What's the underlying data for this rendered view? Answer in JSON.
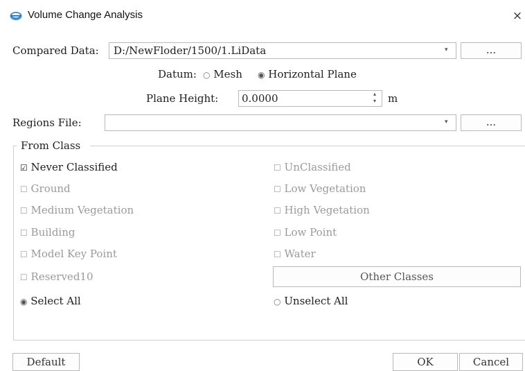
{
  "window": {
    "title": "Volume Change Analysis",
    "close_glyph": "×"
  },
  "compared_data": {
    "label": "Compared Data:",
    "value": "D:/NewFloder/1500/1.LiData",
    "browse_label": "..."
  },
  "datum": {
    "label": "Datum:",
    "options": [
      "Mesh",
      "Horizontal Plane"
    ],
    "selected": "Horizontal Plane"
  },
  "plane_height": {
    "label": "Plane Height:",
    "value": "0.0000",
    "unit": "m"
  },
  "regions_file": {
    "label": "Regions File:",
    "value": "",
    "browse_label": "..."
  },
  "from_class": {
    "legend": "From Class",
    "classes": [
      {
        "label": "Never Classified",
        "checked": true,
        "enabled": true
      },
      {
        "label": "UnClassified",
        "checked": false,
        "enabled": false
      },
      {
        "label": "Ground",
        "checked": false,
        "enabled": false
      },
      {
        "label": "Low Vegetation",
        "checked": false,
        "enabled": false
      },
      {
        "label": "Medium Vegetation",
        "checked": false,
        "enabled": false
      },
      {
        "label": "High Vegetation",
        "checked": false,
        "enabled": false
      },
      {
        "label": "Building",
        "checked": false,
        "enabled": false
      },
      {
        "label": "Low Point",
        "checked": false,
        "enabled": false
      },
      {
        "label": "Model Key Point",
        "checked": false,
        "enabled": false
      },
      {
        "label": "Water",
        "checked": false,
        "enabled": false
      },
      {
        "label": "Reserved10",
        "checked": false,
        "enabled": false
      }
    ],
    "other_classes_label": "Other Classes",
    "select_all_label": "Select All",
    "unselect_all_label": "Unselect All",
    "selection_mode": "Select All"
  },
  "footer": {
    "default_label": "Default",
    "ok_label": "OK",
    "cancel_label": "Cancel"
  },
  "colors": {
    "enabled_text": "#1e1e1e",
    "disabled_text": "#9a9a9a",
    "border": "#b9b9b9",
    "icon_blue": "#3a8fd6"
  },
  "icons": {
    "app": "app-logo-icon",
    "close": "close-icon",
    "dropdown": "chevron-down-icon",
    "spinner": "spinner-arrows-icon"
  }
}
